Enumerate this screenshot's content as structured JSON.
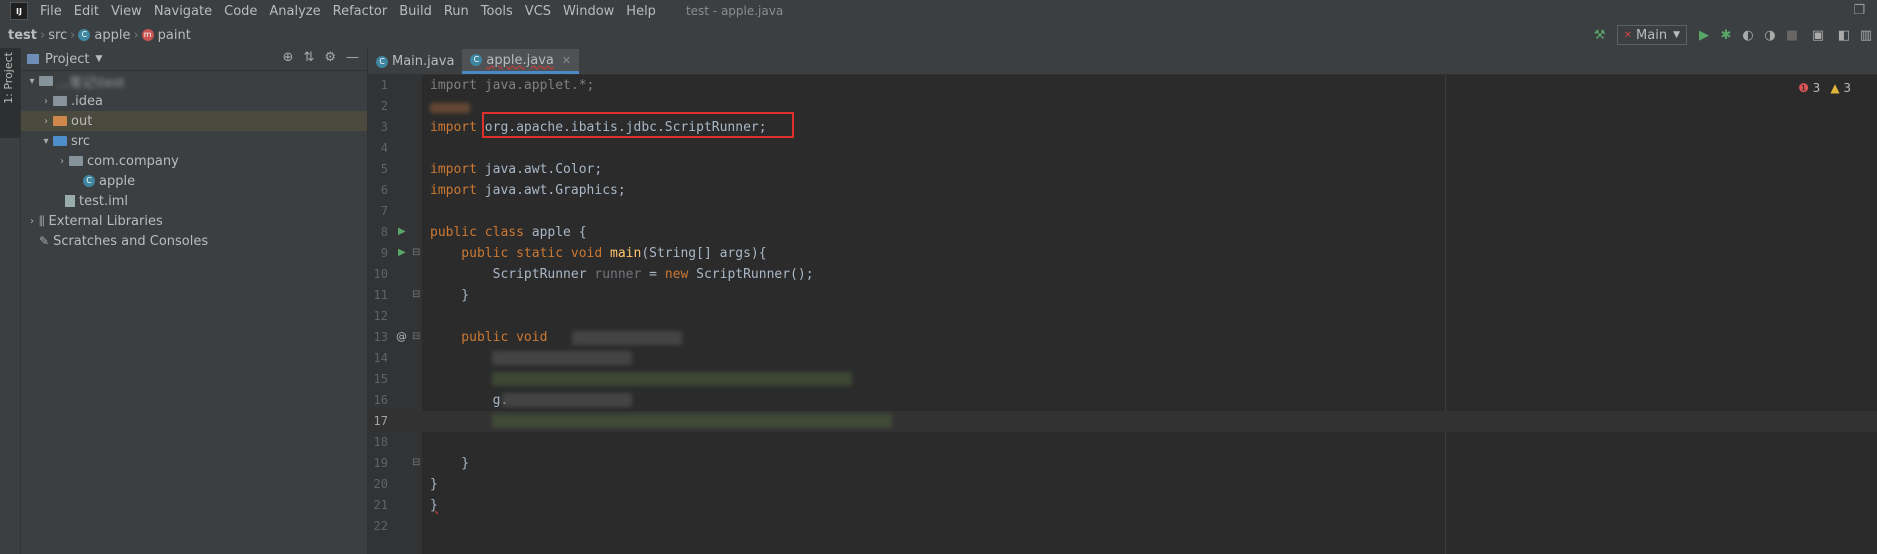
{
  "menubar": {
    "items": [
      "File",
      "Edit",
      "View",
      "Navigate",
      "Code",
      "Analyze",
      "Refactor",
      "Build",
      "Run",
      "Tools",
      "VCS",
      "Window",
      "Help"
    ],
    "window_title": "test - apple.java"
  },
  "breadcrumb": {
    "items": [
      "test",
      "src",
      "apple",
      "paint"
    ]
  },
  "toolbar": {
    "run_config": "Main"
  },
  "sidebar": {
    "project_tab": "1: Project"
  },
  "project": {
    "title": "Project",
    "tree": [
      {
        "label": "...笔记\\test"
      },
      {
        "label": ".idea"
      },
      {
        "label": "out"
      },
      {
        "label": "src"
      },
      {
        "label": "com.company"
      },
      {
        "label": "apple"
      },
      {
        "label": "test.iml"
      },
      {
        "label": "External Libraries"
      },
      {
        "label": "Scratches and Consoles"
      }
    ]
  },
  "tabs": [
    {
      "label": "Main.java"
    },
    {
      "label": "apple.java"
    }
  ],
  "inspections": {
    "errors": "3",
    "warnings": "3"
  },
  "code_lines": [
    "1",
    "2",
    "3",
    "4",
    "5",
    "6",
    "7",
    "8",
    "9",
    "10",
    "11",
    "12",
    "13",
    "14",
    "15",
    "16",
    "17",
    "18",
    "19",
    "20",
    "21",
    "22"
  ],
  "code": {
    "l1": "import java.applet.*;",
    "l3_kw": "import",
    "l3_rest": " org.apache.ibatis.jdbc.ScriptRunner;",
    "l5_kw": "import",
    "l5_rest": " java.awt.Color;",
    "l6_kw": "import",
    "l6_rest": " java.awt.Graphics;",
    "l8_kw": "public class",
    "l8_rest": " apple {",
    "l9_kw": "    public static void",
    "l9_fn": " main",
    "l9_rest": "(String[] args){",
    "l10_a": "        ScriptRunner ",
    "l10_b": "runner",
    "l10_c": " = ",
    "l10_d": "new",
    "l10_e": " ScriptRunner();",
    "l11": "    }",
    "l13_kw": "    public void",
    "l16": "        g.",
    "l19": "    }",
    "l20": "}",
    "l21": "}"
  }
}
